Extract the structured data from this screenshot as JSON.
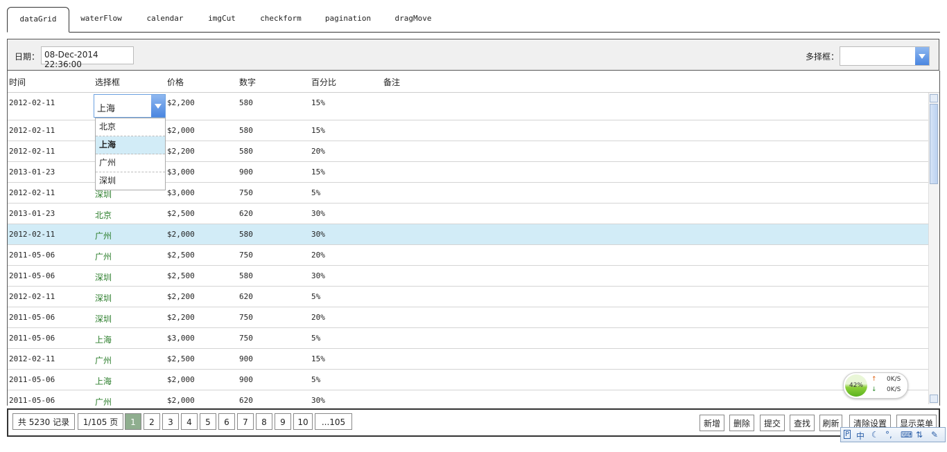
{
  "tabs": [
    "dataGrid",
    "waterFlow",
    "calendar",
    "imgCut",
    "checkform",
    "pagination",
    "dragMove"
  ],
  "toolbar": {
    "date_label": "日期：",
    "date_value": "08-Dec-2014 22:36:00",
    "multi_label": "多择框："
  },
  "grid": {
    "headers": [
      "时间",
      "选择框",
      "价格",
      "数字",
      "百分比",
      "备注"
    ],
    "rows": [
      {
        "date": "2012-02-11",
        "city": "",
        "price": "$2,200",
        "num": "580",
        "pct": "15%"
      },
      {
        "date": "2012-02-11",
        "city": "",
        "price": "$2,000",
        "num": "580",
        "pct": "15%"
      },
      {
        "date": "2012-02-11",
        "city": "",
        "price": "$2,200",
        "num": "580",
        "pct": "20%"
      },
      {
        "date": "2013-01-23",
        "city": "",
        "price": "$3,000",
        "num": "900",
        "pct": "15%"
      },
      {
        "date": "2012-02-11",
        "city": "深圳",
        "price": "$3,000",
        "num": "750",
        "pct": "5%"
      },
      {
        "date": "2013-01-23",
        "city": "北京",
        "price": "$2,500",
        "num": "620",
        "pct": "30%"
      },
      {
        "date": "2012-02-11",
        "city": "广州",
        "price": "$2,000",
        "num": "580",
        "pct": "30%"
      },
      {
        "date": "2011-05-06",
        "city": "广州",
        "price": "$2,500",
        "num": "750",
        "pct": "20%"
      },
      {
        "date": "2011-05-06",
        "city": "深圳",
        "price": "$2,500",
        "num": "580",
        "pct": "30%"
      },
      {
        "date": "2012-02-11",
        "city": "深圳",
        "price": "$2,200",
        "num": "620",
        "pct": "5%"
      },
      {
        "date": "2011-05-06",
        "city": "深圳",
        "price": "$2,200",
        "num": "750",
        "pct": "20%"
      },
      {
        "date": "2011-05-06",
        "city": "上海",
        "price": "$3,000",
        "num": "750",
        "pct": "5%"
      },
      {
        "date": "2012-02-11",
        "city": "广州",
        "price": "$2,500",
        "num": "900",
        "pct": "15%"
      },
      {
        "date": "2011-05-06",
        "city": "上海",
        "price": "$2,000",
        "num": "900",
        "pct": "5%"
      },
      {
        "date": "2011-05-06",
        "city": "广州",
        "price": "$2,000",
        "num": "620",
        "pct": "30%"
      }
    ],
    "editor_value": "上海",
    "dropdown_options": [
      "北京",
      "上海",
      "广州",
      "深圳"
    ]
  },
  "pager": {
    "total": "共 5230 记录",
    "page_info": "1/105 页",
    "pages": [
      "1",
      "2",
      "3",
      "4",
      "5",
      "6",
      "7",
      "8",
      "9",
      "10",
      "...105"
    ],
    "actions": [
      "新增",
      "删除",
      "提交",
      "查找",
      "刷新",
      "清除设置",
      "显示菜单"
    ]
  },
  "speed_widget": {
    "percent": "42%",
    "up": "0K/S",
    "down": "0K/S"
  },
  "ime": {
    "mode": "中"
  }
}
